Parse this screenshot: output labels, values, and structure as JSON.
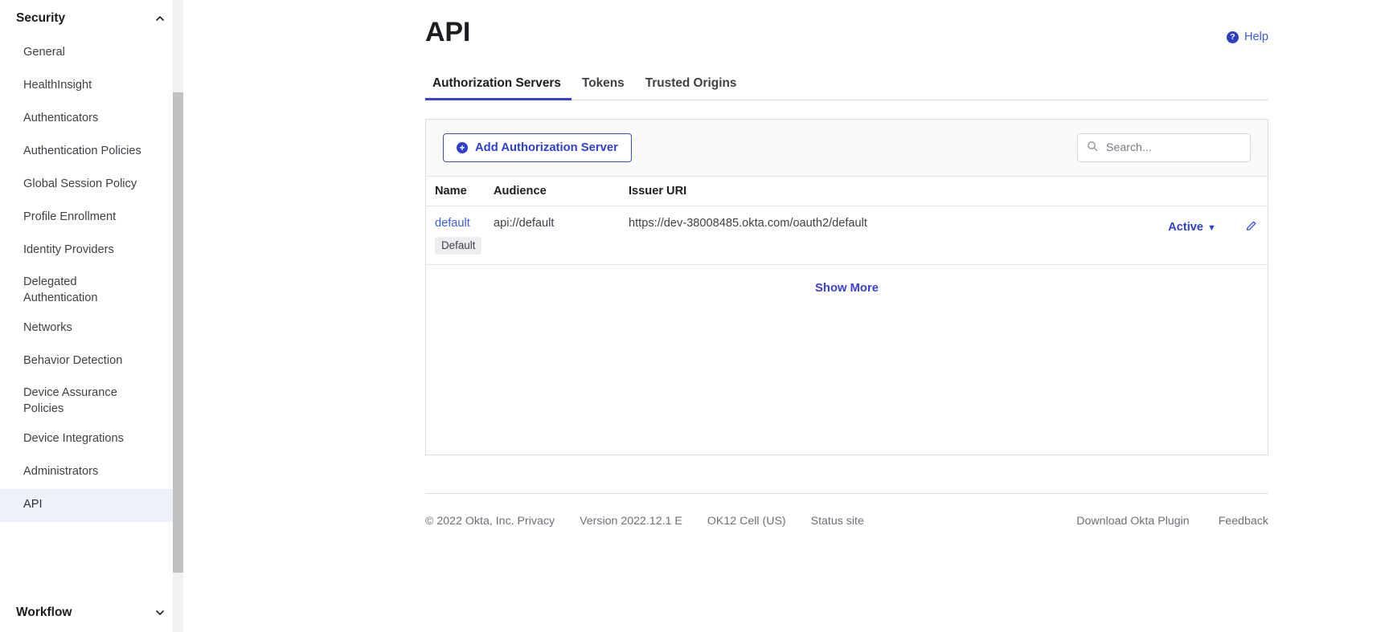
{
  "sidebar": {
    "security": {
      "label": "Security",
      "expanded": true,
      "chevron": "chevron-up-icon"
    },
    "items": [
      {
        "label": "General",
        "active": false
      },
      {
        "label": "HealthInsight",
        "active": false
      },
      {
        "label": "Authenticators",
        "active": false
      },
      {
        "label": "Authentication Policies",
        "active": false
      },
      {
        "label": "Global Session Policy",
        "active": false
      },
      {
        "label": "Profile Enrollment",
        "active": false
      },
      {
        "label": "Identity Providers",
        "active": false
      },
      {
        "label": "Delegated Authentication",
        "active": false
      },
      {
        "label": "Networks",
        "active": false
      },
      {
        "label": "Behavior Detection",
        "active": false
      },
      {
        "label": "Device Assurance Policies",
        "active": false
      },
      {
        "label": "Device Integrations",
        "active": false
      },
      {
        "label": "Administrators",
        "active": false
      },
      {
        "label": "API",
        "active": true
      }
    ],
    "workflow": {
      "label": "Workflow",
      "expanded": false,
      "chevron": "chevron-down-icon"
    },
    "highlight_color": "#eef0fb"
  },
  "header": {
    "title": "API",
    "help_label": "Help",
    "help_icon": "question-circle-icon",
    "help_color": "#3b5cdb"
  },
  "tabs": [
    {
      "label": "Authorization Servers",
      "active": true
    },
    {
      "label": "Tokens",
      "active": false
    },
    {
      "label": "Trusted Origins",
      "active": false
    }
  ],
  "tab_accent_color": "#3b3fd8",
  "toolbar": {
    "add_button_label": "Add Authorization Server",
    "add_button_icon": "plus-circle-icon",
    "add_button_color": "#2f40cf",
    "search_placeholder": "Search...",
    "search_value": "",
    "search_icon": "search-icon"
  },
  "table": {
    "columns": [
      "Name",
      "Audience",
      "Issuer URI"
    ],
    "rows": [
      {
        "name": "default",
        "badge": "Default",
        "audience": "api://default",
        "issuer_uri": "https://dev-38008485.okta.com/oauth2/default",
        "status": "Active",
        "status_caret": "▼",
        "edit_icon": "pencil-edit-icon"
      }
    ],
    "show_more_label": "Show More",
    "link_color": "#3b5cdb"
  },
  "footer": {
    "left": [
      "© 2022 Okta, Inc. Privacy",
      "Version 2022.12.1 E",
      "OK12 Cell (US)",
      "Status site"
    ],
    "right": [
      "Download Okta Plugin",
      "Feedback"
    ]
  }
}
